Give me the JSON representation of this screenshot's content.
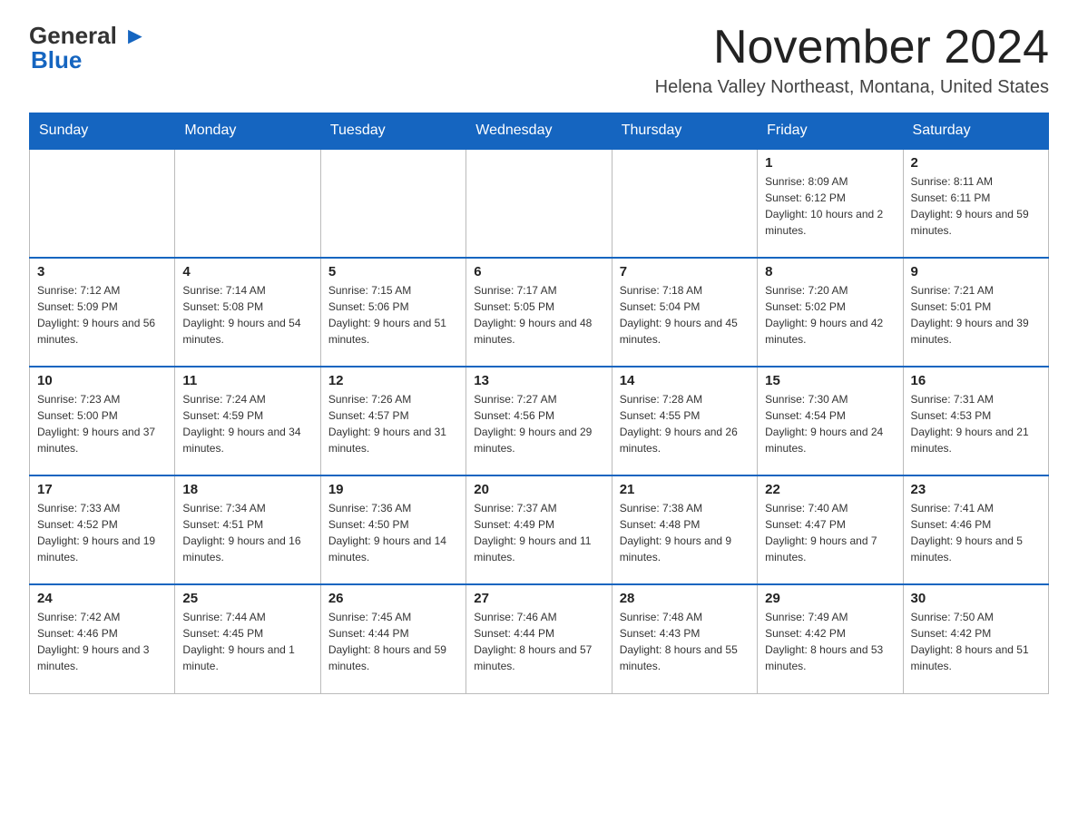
{
  "header": {
    "logo_general": "General",
    "logo_blue": "Blue",
    "month_title": "November 2024",
    "location": "Helena Valley Northeast, Montana, United States"
  },
  "weekdays": [
    "Sunday",
    "Monday",
    "Tuesday",
    "Wednesday",
    "Thursday",
    "Friday",
    "Saturday"
  ],
  "weeks": [
    [
      {
        "day": "",
        "sunrise": "",
        "sunset": "",
        "daylight": ""
      },
      {
        "day": "",
        "sunrise": "",
        "sunset": "",
        "daylight": ""
      },
      {
        "day": "",
        "sunrise": "",
        "sunset": "",
        "daylight": ""
      },
      {
        "day": "",
        "sunrise": "",
        "sunset": "",
        "daylight": ""
      },
      {
        "day": "",
        "sunrise": "",
        "sunset": "",
        "daylight": ""
      },
      {
        "day": "1",
        "sunrise": "Sunrise: 8:09 AM",
        "sunset": "Sunset: 6:12 PM",
        "daylight": "Daylight: 10 hours and 2 minutes."
      },
      {
        "day": "2",
        "sunrise": "Sunrise: 8:11 AM",
        "sunset": "Sunset: 6:11 PM",
        "daylight": "Daylight: 9 hours and 59 minutes."
      }
    ],
    [
      {
        "day": "3",
        "sunrise": "Sunrise: 7:12 AM",
        "sunset": "Sunset: 5:09 PM",
        "daylight": "Daylight: 9 hours and 56 minutes."
      },
      {
        "day": "4",
        "sunrise": "Sunrise: 7:14 AM",
        "sunset": "Sunset: 5:08 PM",
        "daylight": "Daylight: 9 hours and 54 minutes."
      },
      {
        "day": "5",
        "sunrise": "Sunrise: 7:15 AM",
        "sunset": "Sunset: 5:06 PM",
        "daylight": "Daylight: 9 hours and 51 minutes."
      },
      {
        "day": "6",
        "sunrise": "Sunrise: 7:17 AM",
        "sunset": "Sunset: 5:05 PM",
        "daylight": "Daylight: 9 hours and 48 minutes."
      },
      {
        "day": "7",
        "sunrise": "Sunrise: 7:18 AM",
        "sunset": "Sunset: 5:04 PM",
        "daylight": "Daylight: 9 hours and 45 minutes."
      },
      {
        "day": "8",
        "sunrise": "Sunrise: 7:20 AM",
        "sunset": "Sunset: 5:02 PM",
        "daylight": "Daylight: 9 hours and 42 minutes."
      },
      {
        "day": "9",
        "sunrise": "Sunrise: 7:21 AM",
        "sunset": "Sunset: 5:01 PM",
        "daylight": "Daylight: 9 hours and 39 minutes."
      }
    ],
    [
      {
        "day": "10",
        "sunrise": "Sunrise: 7:23 AM",
        "sunset": "Sunset: 5:00 PM",
        "daylight": "Daylight: 9 hours and 37 minutes."
      },
      {
        "day": "11",
        "sunrise": "Sunrise: 7:24 AM",
        "sunset": "Sunset: 4:59 PM",
        "daylight": "Daylight: 9 hours and 34 minutes."
      },
      {
        "day": "12",
        "sunrise": "Sunrise: 7:26 AM",
        "sunset": "Sunset: 4:57 PM",
        "daylight": "Daylight: 9 hours and 31 minutes."
      },
      {
        "day": "13",
        "sunrise": "Sunrise: 7:27 AM",
        "sunset": "Sunset: 4:56 PM",
        "daylight": "Daylight: 9 hours and 29 minutes."
      },
      {
        "day": "14",
        "sunrise": "Sunrise: 7:28 AM",
        "sunset": "Sunset: 4:55 PM",
        "daylight": "Daylight: 9 hours and 26 minutes."
      },
      {
        "day": "15",
        "sunrise": "Sunrise: 7:30 AM",
        "sunset": "Sunset: 4:54 PM",
        "daylight": "Daylight: 9 hours and 24 minutes."
      },
      {
        "day": "16",
        "sunrise": "Sunrise: 7:31 AM",
        "sunset": "Sunset: 4:53 PM",
        "daylight": "Daylight: 9 hours and 21 minutes."
      }
    ],
    [
      {
        "day": "17",
        "sunrise": "Sunrise: 7:33 AM",
        "sunset": "Sunset: 4:52 PM",
        "daylight": "Daylight: 9 hours and 19 minutes."
      },
      {
        "day": "18",
        "sunrise": "Sunrise: 7:34 AM",
        "sunset": "Sunset: 4:51 PM",
        "daylight": "Daylight: 9 hours and 16 minutes."
      },
      {
        "day": "19",
        "sunrise": "Sunrise: 7:36 AM",
        "sunset": "Sunset: 4:50 PM",
        "daylight": "Daylight: 9 hours and 14 minutes."
      },
      {
        "day": "20",
        "sunrise": "Sunrise: 7:37 AM",
        "sunset": "Sunset: 4:49 PM",
        "daylight": "Daylight: 9 hours and 11 minutes."
      },
      {
        "day": "21",
        "sunrise": "Sunrise: 7:38 AM",
        "sunset": "Sunset: 4:48 PM",
        "daylight": "Daylight: 9 hours and 9 minutes."
      },
      {
        "day": "22",
        "sunrise": "Sunrise: 7:40 AM",
        "sunset": "Sunset: 4:47 PM",
        "daylight": "Daylight: 9 hours and 7 minutes."
      },
      {
        "day": "23",
        "sunrise": "Sunrise: 7:41 AM",
        "sunset": "Sunset: 4:46 PM",
        "daylight": "Daylight: 9 hours and 5 minutes."
      }
    ],
    [
      {
        "day": "24",
        "sunrise": "Sunrise: 7:42 AM",
        "sunset": "Sunset: 4:46 PM",
        "daylight": "Daylight: 9 hours and 3 minutes."
      },
      {
        "day": "25",
        "sunrise": "Sunrise: 7:44 AM",
        "sunset": "Sunset: 4:45 PM",
        "daylight": "Daylight: 9 hours and 1 minute."
      },
      {
        "day": "26",
        "sunrise": "Sunrise: 7:45 AM",
        "sunset": "Sunset: 4:44 PM",
        "daylight": "Daylight: 8 hours and 59 minutes."
      },
      {
        "day": "27",
        "sunrise": "Sunrise: 7:46 AM",
        "sunset": "Sunset: 4:44 PM",
        "daylight": "Daylight: 8 hours and 57 minutes."
      },
      {
        "day": "28",
        "sunrise": "Sunrise: 7:48 AM",
        "sunset": "Sunset: 4:43 PM",
        "daylight": "Daylight: 8 hours and 55 minutes."
      },
      {
        "day": "29",
        "sunrise": "Sunrise: 7:49 AM",
        "sunset": "Sunset: 4:42 PM",
        "daylight": "Daylight: 8 hours and 53 minutes."
      },
      {
        "day": "30",
        "sunrise": "Sunrise: 7:50 AM",
        "sunset": "Sunset: 4:42 PM",
        "daylight": "Daylight: 8 hours and 51 minutes."
      }
    ]
  ]
}
